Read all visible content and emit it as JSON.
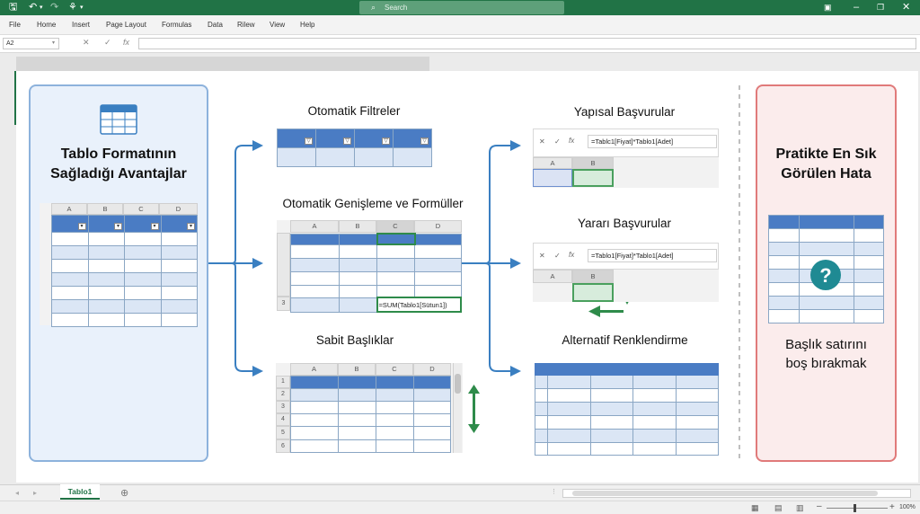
{
  "window": {
    "search_placeholder": "Search"
  },
  "menu": [
    "File",
    "Home",
    "Insert",
    "Page Layout",
    "Formulas",
    "Data",
    "Rilew",
    "View",
    "Help"
  ],
  "formula_bar": {
    "name_box": "A2",
    "fx": "fx"
  },
  "left_panel": {
    "title_line1": "Tablo Formatının",
    "title_line2": "Sağladığı Avantajlar",
    "columns": [
      "A",
      "B",
      "C",
      "D"
    ]
  },
  "sections": {
    "filters": {
      "title": "Otomatik Filtreler"
    },
    "expansion": {
      "title": "Otomatik Genişleme ve Formüller",
      "columns": [
        "A",
        "B",
        "C",
        "D"
      ],
      "row_number": "3",
      "formula": "=SUM(Tablo1[Sütun1])"
    },
    "fixed_headers": {
      "title": "Sabit Başlıklar",
      "columns": [
        "A",
        "B",
        "C",
        "D"
      ],
      "rows": [
        "1",
        "2",
        "3",
        "4",
        "5",
        "6"
      ]
    },
    "structured_refs": {
      "title": "Yapısal Başvurular",
      "formula": "=Tablc1[Fiyat]*Tablo1[Adet]",
      "columns": [
        "A",
        "B"
      ]
    },
    "semi_refs": {
      "title": "Yararı Başvurular",
      "formula": "=Tablo1[Fiyat]*Tablo1[Adet]",
      "columns": [
        "A",
        "B"
      ]
    },
    "banding": {
      "title": "Alternatif Renklendirme"
    }
  },
  "right_panel": {
    "title_line1": "Pratikte En Sık",
    "title_line2": "Görülen Hata",
    "caption_line1": "Başlık satırını",
    "caption_line2": "boş bırakmak"
  },
  "sheet_tabs": {
    "active": "Tablo1"
  },
  "status": {
    "zoom": "100%"
  },
  "colors": {
    "excel_green": "#217346",
    "header_blue": "#4a7cc4",
    "band_blue": "#dbe6f5",
    "accent_arrow": "#3a7fc1",
    "warning_red": "#d93a3a",
    "help_teal": "#1f8a93"
  }
}
